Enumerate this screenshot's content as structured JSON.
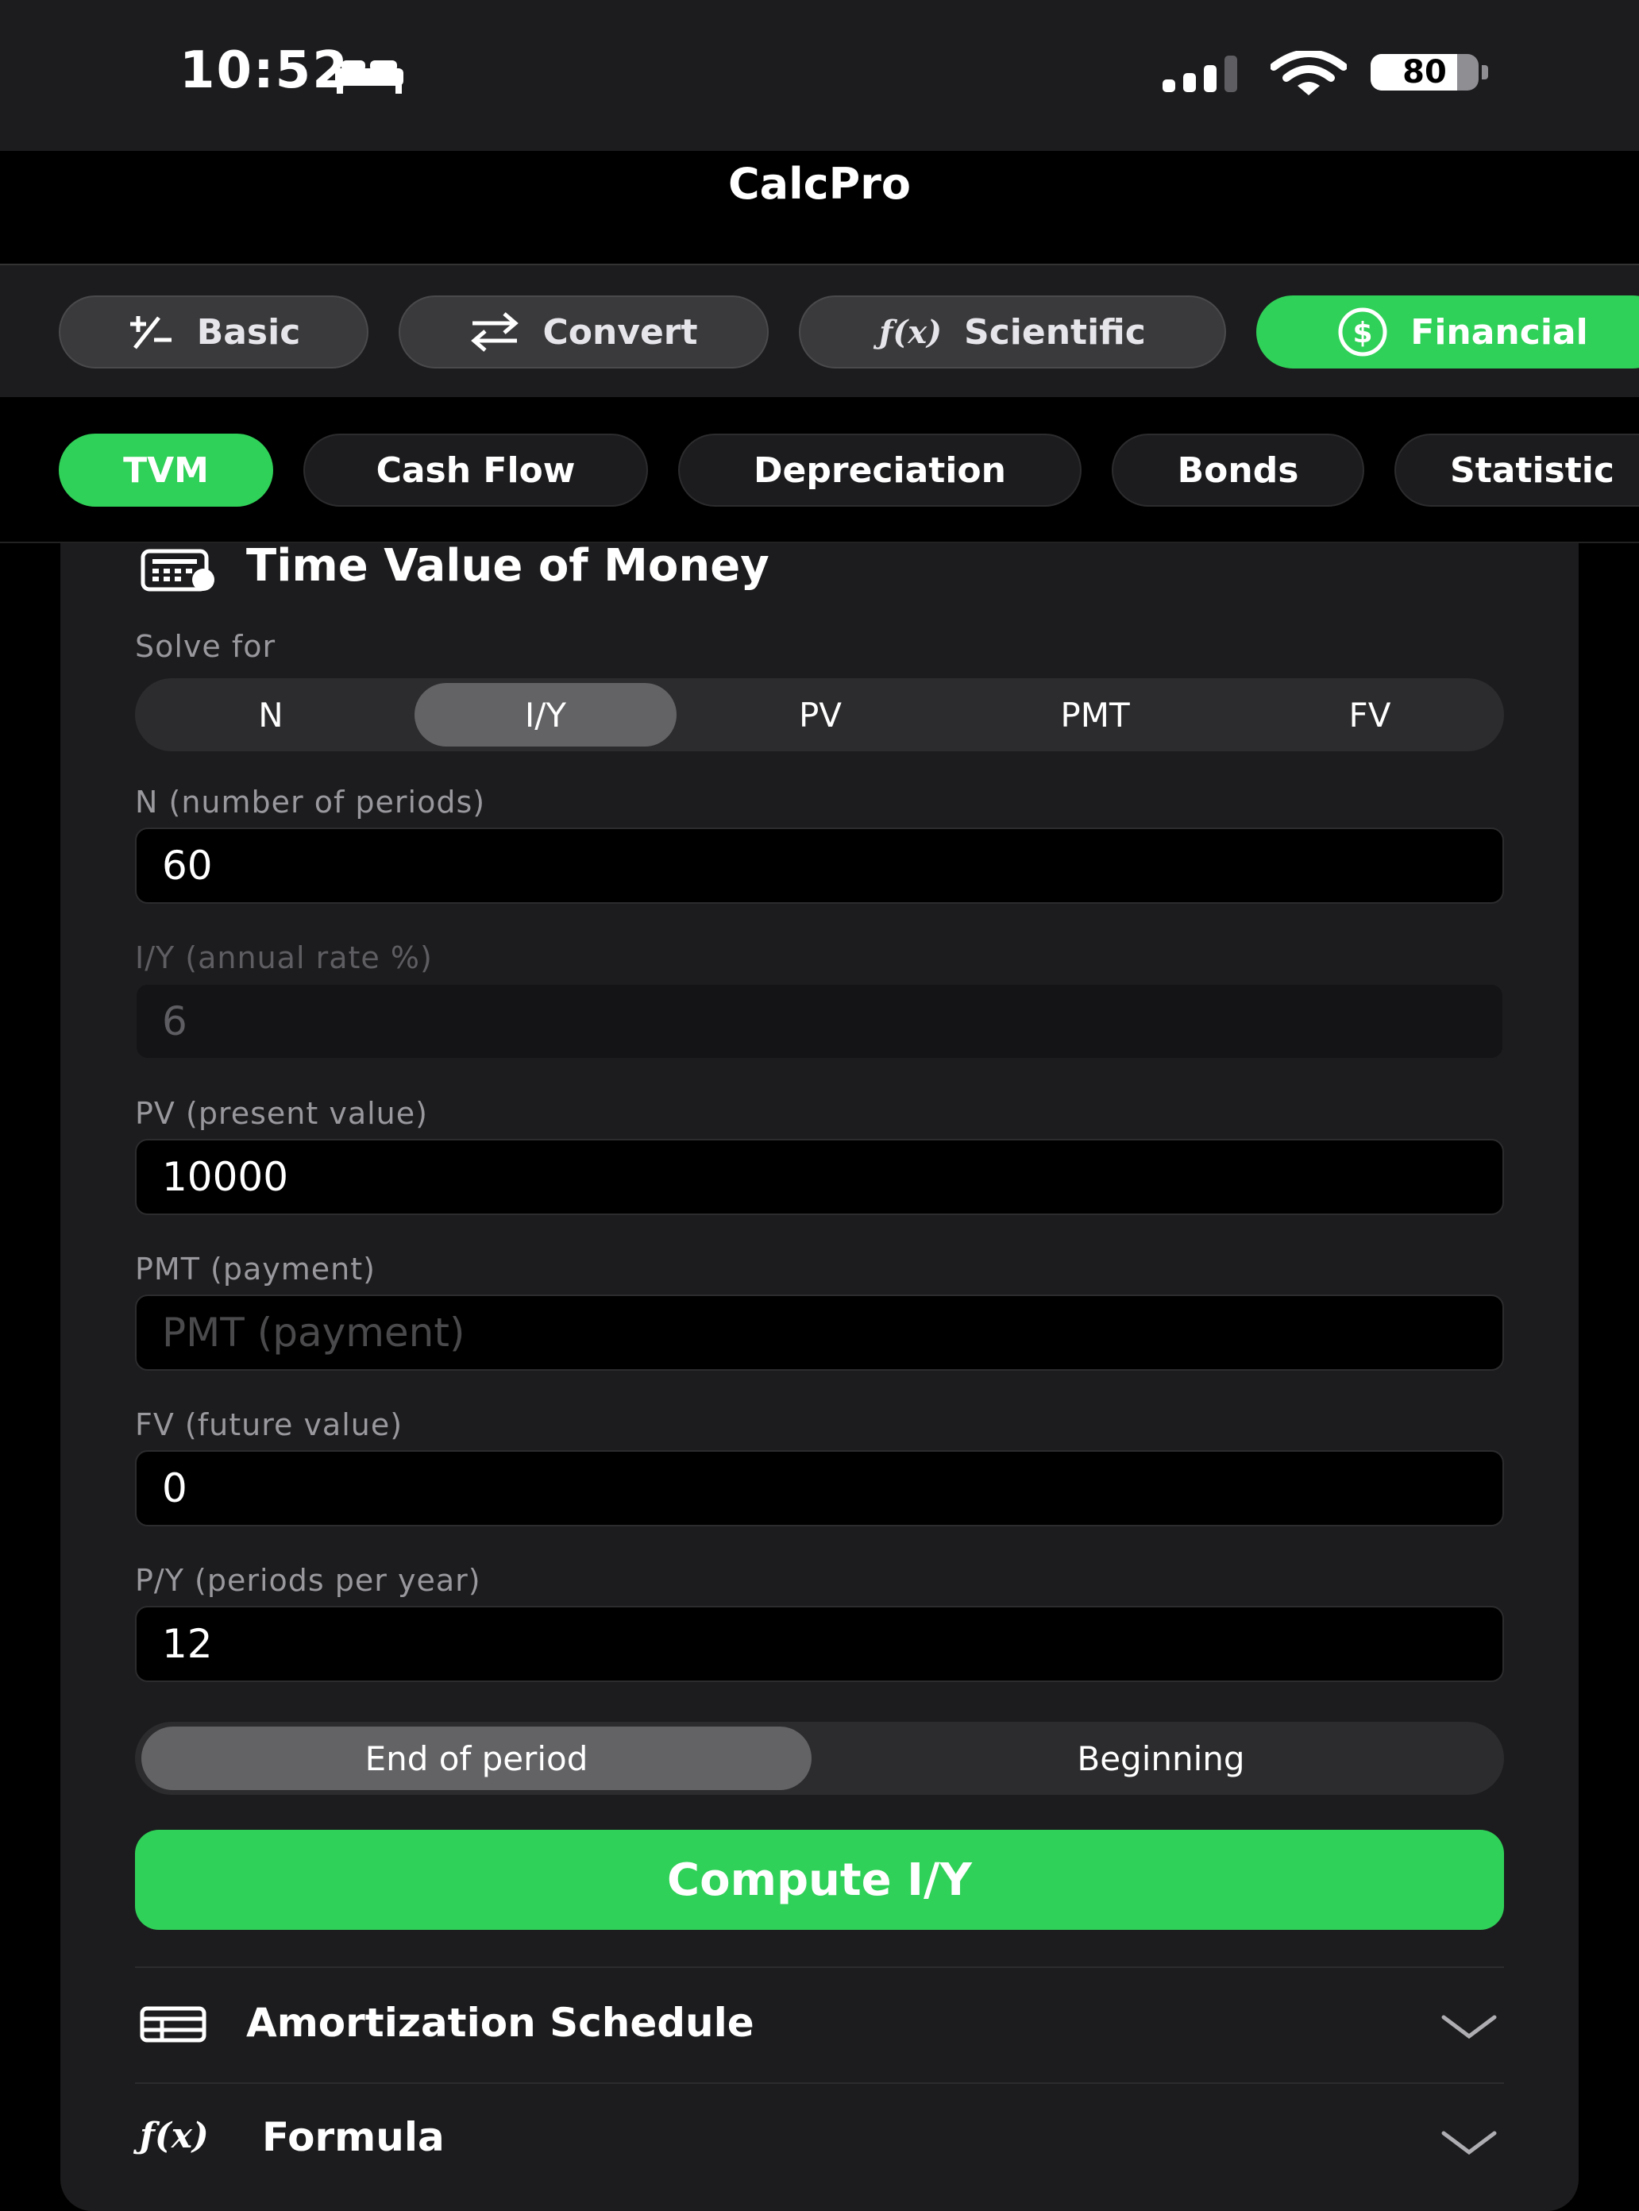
{
  "status": {
    "time": "10:52",
    "battery": "80"
  },
  "app": {
    "title": "CalcPro"
  },
  "modes": [
    {
      "label": "Basic",
      "icon": "plus-minus-icon"
    },
    {
      "label": "Convert",
      "icon": "swap-arrows-icon"
    },
    {
      "label": "Scientific",
      "icon": "fx-icon"
    },
    {
      "label": "Financial",
      "icon": "dollar-circle-icon",
      "active": true
    }
  ],
  "subtabs": [
    "TVM",
    "Cash Flow",
    "Depreciation",
    "Bonds",
    "Statistic"
  ],
  "tvm": {
    "title": "Time Value of Money",
    "solve_for_label": "Solve for",
    "solve_options": [
      "N",
      "I/Y",
      "PV",
      "PMT",
      "FV"
    ],
    "selected": "I/Y",
    "fields": {
      "n": {
        "label": "N  (number of periods)",
        "value": "60"
      },
      "iy": {
        "label": "I/Y  (annual rate %)",
        "value": "6"
      },
      "pv": {
        "label": "PV  (present value)",
        "value": "10000"
      },
      "pmt": {
        "label": "PMT  (payment)",
        "placeholder": "PMT  (payment)"
      },
      "fv": {
        "label": "FV  (future value)",
        "value": "0"
      },
      "py": {
        "label": "P/Y  (periods per year)",
        "value": "12"
      }
    },
    "timing": {
      "end": "End of period",
      "begin": "Beginning"
    },
    "compute_label": "Compute I/Y",
    "amortization_label": "Amortization Schedule",
    "formula_label": "Formula"
  },
  "colors": {
    "accent": "#30d158",
    "background": "#000000",
    "card": "#1c1c1e"
  }
}
